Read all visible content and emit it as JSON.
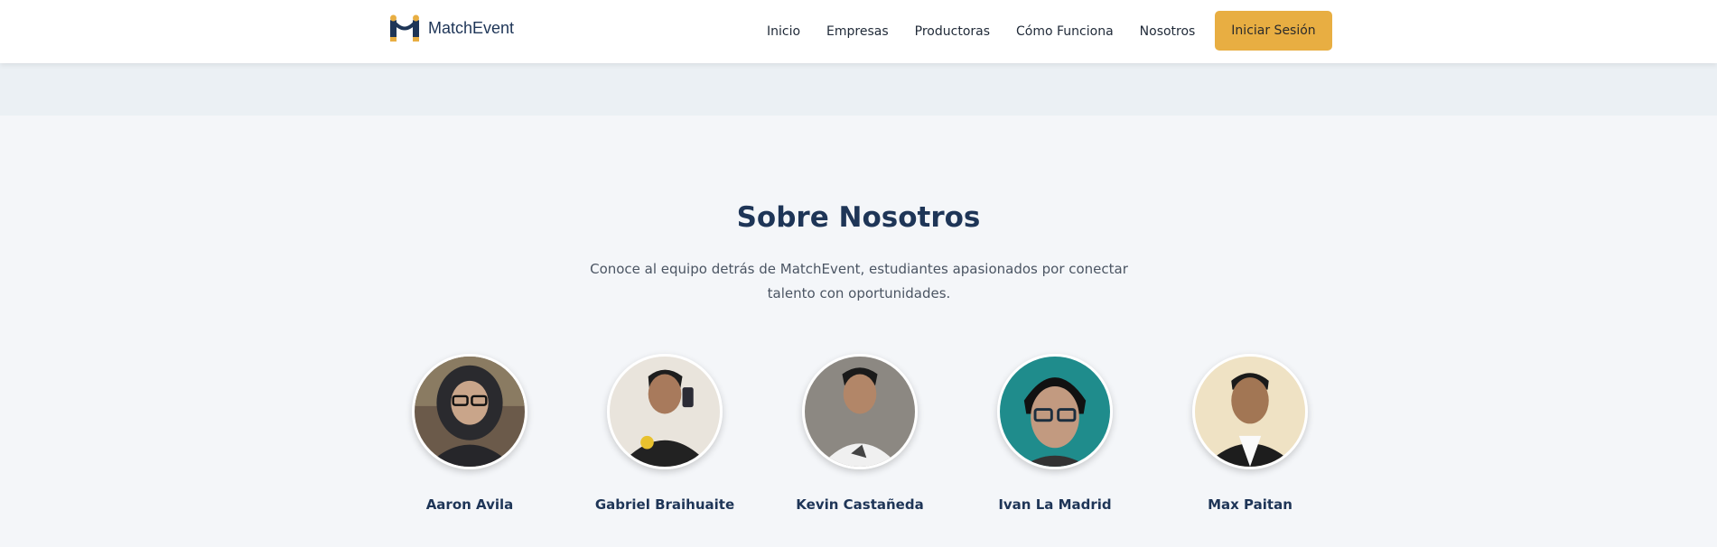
{
  "navbar": {
    "brand": "MatchEvent",
    "links": [
      "Inicio",
      "Empresas",
      "Productoras",
      "Cómo Funciona",
      "Nosotros"
    ],
    "login_label": "Iniciar Sesión"
  },
  "about": {
    "title": "Sobre Nosotros",
    "subtitle": "Conoce al equipo detrás de MatchEvent, estudiantes apasionados por conectar talento con oportunidades."
  },
  "team": [
    {
      "name": "Aaron Avila"
    },
    {
      "name": "Gabriel Braihuaite"
    },
    {
      "name": "Kevin Castañeda"
    },
    {
      "name": "Ivan La Madrid"
    },
    {
      "name": "Max Paitan"
    }
  ],
  "colors": {
    "accent": "#e8ae42",
    "heading": "#1e3557",
    "background": "#f4f6f9"
  },
  "icons": {
    "brand": "match-event-logo-icon"
  }
}
